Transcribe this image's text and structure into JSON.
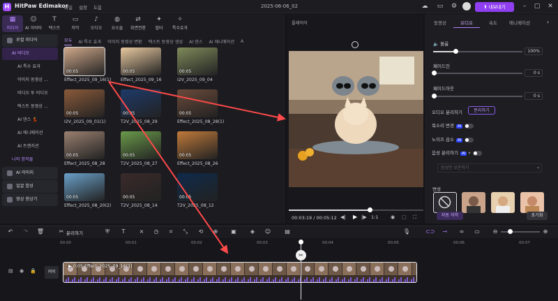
{
  "app": {
    "name": "HitPaw Edimakor",
    "menu": [
      "파일",
      "설정",
      "도움"
    ],
    "date": "2025-06-06_02",
    "upgrade_label": "내보내기"
  },
  "top_categories": [
    {
      "icon": "media-icon",
      "label": "미디어",
      "active": true
    },
    {
      "icon": "ai-avatar-icon",
      "label": "AI 아바타"
    },
    {
      "icon": "text-icon",
      "label": "텍스트"
    },
    {
      "icon": "subtitle-icon",
      "label": "자막"
    },
    {
      "icon": "audio-icon",
      "label": "오디오"
    },
    {
      "icon": "elements-icon",
      "label": "요소들"
    },
    {
      "icon": "transition-icon",
      "label": "화면전환"
    },
    {
      "icon": "filter-icon",
      "label": "필터"
    },
    {
      "icon": "effects-icon",
      "label": "특수효과"
    }
  ],
  "sidebar": [
    {
      "label": "로컬 미디어",
      "kind": "hdr"
    },
    {
      "label": "AI 비디오",
      "kind": "active"
    },
    {
      "label": "AI 특수 효과",
      "kind": "sub"
    },
    {
      "label": "이미지 동영상 ...",
      "kind": "sub"
    },
    {
      "label": "비디오 투 비디오",
      "kind": "sub"
    },
    {
      "label": "텍스트 동영상 ...",
      "kind": "sub"
    },
    {
      "label": "AI 댄스 💃",
      "kind": "sub"
    },
    {
      "label": "AI 애니메이션",
      "kind": "sub"
    },
    {
      "label": "AI 트랜지션",
      "kind": "sub"
    },
    {
      "label": "나의 창작물",
      "kind": "purple"
    },
    {
      "label": "AI 이미지",
      "kind": "hdr"
    },
    {
      "label": "얼굴 합성",
      "kind": "hdr"
    },
    {
      "label": "영상 향상기",
      "kind": "hdr"
    }
  ],
  "subtabs": [
    "모두",
    "AI 특수 효과",
    "이미지 동영상 변환",
    "텍스트 동영상 생성",
    "AI 댄스",
    "AI 애니메이션",
    "A"
  ],
  "media_items": [
    {
      "name": "Effect_2025_09_16(1)",
      "duration": "00:05",
      "color": "#cfa88a",
      "selected": true
    },
    {
      "name": "Effect_2025_09_16",
      "duration": "00:05",
      "color": "#e8c9a0"
    },
    {
      "name": "I2V_2025_09_04",
      "duration": "00:05",
      "color": "#7e8a5a"
    },
    {
      "name": "I2V_2025_09_01(1)",
      "duration": "00:05",
      "color": "#8a5a3a"
    },
    {
      "name": "T2V_2025_08_29",
      "duration": "00:05",
      "color": "#1e3a6a"
    },
    {
      "name": "Effect_2025_08_28(1)",
      "duration": "00:05",
      "color": "#6a4a3a"
    },
    {
      "name": "Effect_2025_08_28",
      "duration": "00:05",
      "color": "#9a8070"
    },
    {
      "name": "T2V_2025_08_27",
      "duration": "00:05",
      "color": "#6a9a4a"
    },
    {
      "name": "Effect_2025_08_26",
      "duration": "00:05",
      "color": "#c07a3a"
    },
    {
      "name": "Effect_2025_08_20(2)",
      "duration": "00:05",
      "color": "#6aa0c8"
    },
    {
      "name": "T2V_2025_08_14",
      "duration": "00:05",
      "color": "#3a2a2a"
    },
    {
      "name": "T2V_2025_08_12",
      "duration": "00:05",
      "color": "#0e2a4a"
    }
  ],
  "player": {
    "title": "플레이어",
    "time_current": "00:03:19",
    "time_total": "00:05:12",
    "speed": "1:1",
    "progress": 0.6
  },
  "right_panel": {
    "tabs": [
      "동영상",
      "오디오",
      "속도",
      "애니메이션"
    ],
    "active_tab": 1,
    "volume_label": "볼륨",
    "volume_value": "100%",
    "volume_level": 1.0,
    "fadein_label": "페이드인",
    "fadein_value": "0",
    "fadein_unit": "s",
    "fadeout_label": "페이드아웃",
    "fadeout_value": "0",
    "fadeout_unit": "s",
    "separate_label": "오디오 분리하기",
    "separate_btn": "분리하기",
    "voice_change_label": "목소리 변경",
    "denoise_label": "노이즈 감소",
    "vocal_sep_label": "음성 분리하기",
    "ai_badge": "AI",
    "dropdown_placeholder": "음성만 보존하기",
    "voice_section_label": "변성",
    "auto_caption_btn": "자동 자막",
    "reset_btn": "초기화"
  },
  "timeline": {
    "ruler": [
      "00:00",
      "00:01",
      "00:02",
      "00:03",
      "00:04",
      "00:05",
      "00:06",
      "00:07"
    ],
    "clip_label": "0:05 Effect_2025_09_16(1)",
    "cover_label": "커버"
  },
  "toolbar_split_label": "분리하기"
}
